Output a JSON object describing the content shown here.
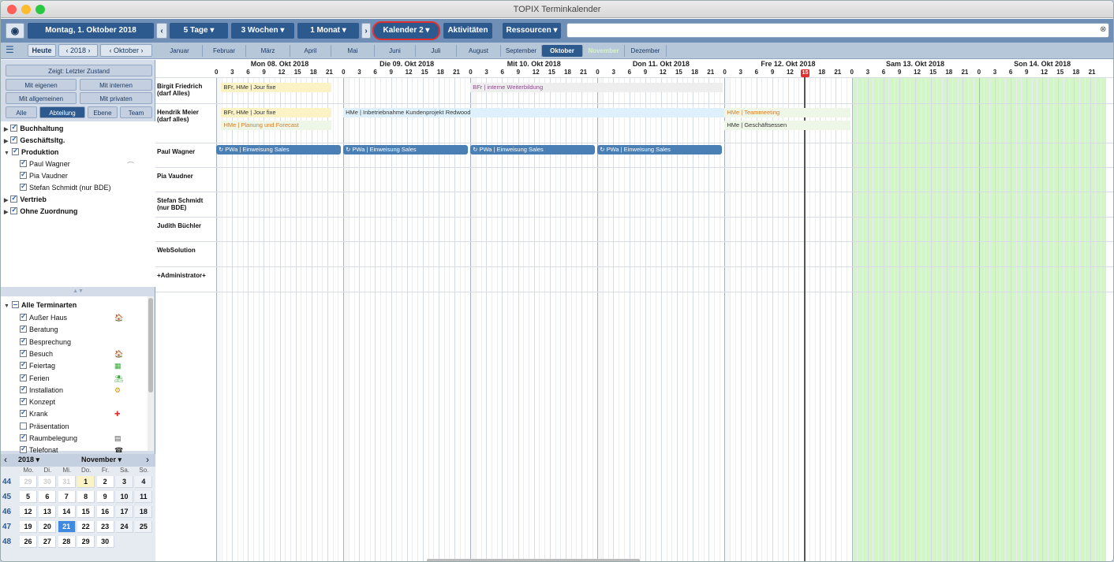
{
  "window": {
    "title": "TOPIX Terminkalender"
  },
  "toolbar": {
    "date_label": "Montag, 1. Oktober 2018",
    "views": [
      "5 Tage",
      "3 Wochen",
      "1 Monat"
    ],
    "calendar_label": "Kalender 2",
    "activities_label": "Aktivitäten",
    "resources_label": "Ressourcen",
    "search_value": ""
  },
  "navbar": {
    "today_label": "Heute",
    "year": "2018",
    "month": "Oktober",
    "months": [
      "Januar",
      "Februar",
      "März",
      "April",
      "Mai",
      "Juni",
      "Juli",
      "August",
      "September",
      "Oktober",
      "November",
      "Dezember"
    ],
    "selected_month": "Oktober"
  },
  "sidebar": {
    "filter_label": "Zeigt: Letzter Zustand",
    "filter_buttons": [
      "Mit eigenen",
      "Mit internen",
      "Mit allgemeinen",
      "Mit privaten"
    ],
    "group_buttons": [
      "Alle",
      "Abteilung",
      "Ebene",
      "Team"
    ],
    "departments": [
      {
        "label": "Buchhaltung",
        "level": 0,
        "checked": true
      },
      {
        "label": "Geschäftsltg.",
        "level": 0,
        "checked": true
      },
      {
        "label": "Produktion",
        "level": 0,
        "checked": true
      },
      {
        "label": "Paul Wagner",
        "level": 1,
        "checked": true
      },
      {
        "label": "Pia Vaudner",
        "level": 1,
        "checked": true
      },
      {
        "label": "Stefan Schmidt (nur BDE)",
        "level": 1,
        "checked": true
      },
      {
        "label": "Vertrieb",
        "level": 0,
        "checked": true
      },
      {
        "label": "Ohne Zuordnung",
        "level": 0,
        "checked": true
      }
    ],
    "types_header": "Alle Terminarten",
    "types": [
      {
        "label": "Außer Haus",
        "checked": true
      },
      {
        "label": "Beratung",
        "checked": true
      },
      {
        "label": "Besprechung",
        "checked": true
      },
      {
        "label": "Besuch",
        "checked": true
      },
      {
        "label": "Feiertag",
        "checked": true
      },
      {
        "label": "Ferien",
        "checked": true
      },
      {
        "label": "Installation",
        "checked": true
      },
      {
        "label": "Konzept",
        "checked": true
      },
      {
        "label": "Krank",
        "checked": true
      },
      {
        "label": "Präsentation",
        "checked": false
      },
      {
        "label": "Raumbelegung",
        "checked": true
      },
      {
        "label": "Telefonat",
        "checked": true
      }
    ]
  },
  "mini_calendar": {
    "year": "2018",
    "month": "November",
    "weekdays": [
      "Mo.",
      "Di.",
      "Mi.",
      "Do.",
      "Fr.",
      "Sa.",
      "So."
    ],
    "weeks": [
      {
        "kw": "44",
        "days": [
          "29",
          "30",
          "31",
          "1",
          "2",
          "3",
          "4"
        ]
      },
      {
        "kw": "45",
        "days": [
          "5",
          "6",
          "7",
          "8",
          "9",
          "10",
          "11"
        ]
      },
      {
        "kw": "46",
        "days": [
          "12",
          "13",
          "14",
          "15",
          "16",
          "17",
          "18"
        ]
      },
      {
        "kw": "47",
        "days": [
          "19",
          "20",
          "21",
          "22",
          "23",
          "24",
          "25"
        ]
      },
      {
        "kw": "48",
        "days": [
          "26",
          "27",
          "28",
          "29",
          "30",
          "",
          ""
        ]
      }
    ]
  },
  "schedule": {
    "days": [
      "Mon 08. Okt 2018",
      "Die 09. Okt 2018",
      "Mit 10. Okt 2018",
      "Don 11. Okt 2018",
      "Fre 12. Okt 2018",
      "Sam 13. Okt 2018",
      "Son 14. Okt 2018"
    ],
    "hours": [
      "0",
      "3",
      "6",
      "9",
      "12",
      "15",
      "18",
      "21"
    ],
    "resources": [
      "Birgit Friedrich (darf Alles)",
      "Hendrik Meier (darf alles)",
      "Paul Wagner",
      "Pia Vaudner",
      "Stefan Schmidt (nur BDE)",
      "Judith Büchler",
      "WebSolution",
      "+Administrator+"
    ],
    "events": [
      {
        "text": "BFr, HMe | Jour fixe"
      },
      {
        "text": "BFr | interne Weiterbildung"
      },
      {
        "text": "BFr, HMe | Jour fixe"
      },
      {
        "text": "HMe | Inbetriebnahme Kundenprojekt Redwood"
      },
      {
        "text": "HMe | Teammeeting"
      },
      {
        "text": "HMe | Planung und Forecast"
      },
      {
        "text": "HMe | Geschäftsessen"
      },
      {
        "text": "PWa | Einweisung Sales"
      },
      {
        "text": "PWa | Einweisung Sales"
      },
      {
        "text": "PWa | Einweisung Sales"
      },
      {
        "text": "PWa | Einweisung Sales"
      }
    ],
    "current_hour_label": "15"
  },
  "colors": {
    "toolbar": "#6f8fb6",
    "selected": "#2c5a8f",
    "highlight_ring": "#e03030",
    "weekend": "#d3f5c9"
  }
}
